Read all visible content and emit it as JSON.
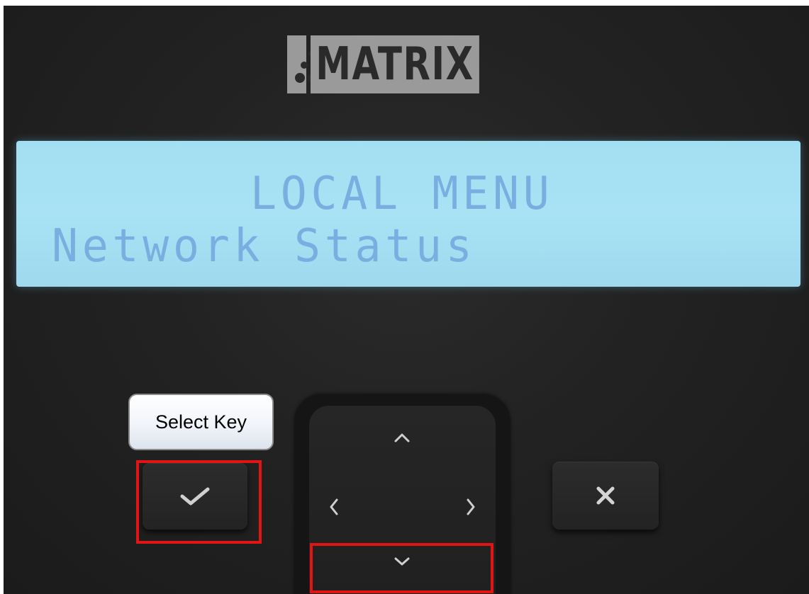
{
  "brand": {
    "name": "MATRIX"
  },
  "lcd": {
    "line1": "LOCAL MENU",
    "line2": "Network Status",
    "backlight_color": "#a6e0f3",
    "text_color": "#7aaee0"
  },
  "callout": {
    "label": "Select Key"
  },
  "keys": {
    "select_icon": "checkmark-icon",
    "cancel_icon": "close-icon",
    "nav_icons": [
      "chevron-up-icon",
      "chevron-left-icon",
      "chevron-right-icon",
      "chevron-down-icon"
    ]
  },
  "highlights": {
    "color": "#e31414",
    "targets": [
      "select-key",
      "nav-down-key"
    ]
  }
}
